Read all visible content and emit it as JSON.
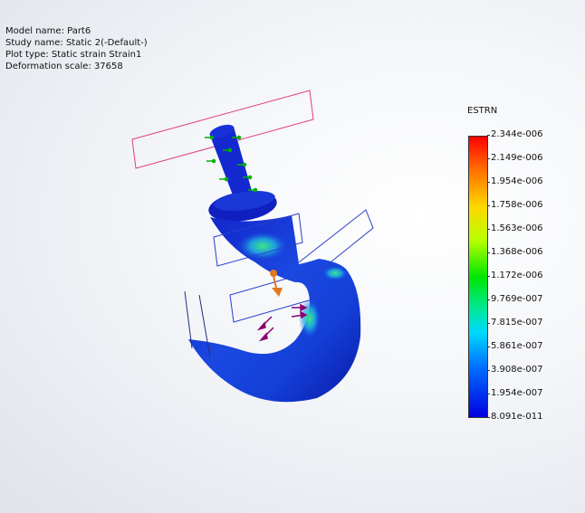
{
  "info": {
    "model_name": "Model name: Part6",
    "study_name": "Study name: Static 2(-Default-)",
    "plot_type": "Plot type: Static strain Strain1",
    "deformation_scale": "Deformation scale: 37658"
  },
  "legend": {
    "title": "ESTRN",
    "ticks": [
      "2.344e-006",
      "2.149e-006",
      "1.954e-006",
      "1.758e-006",
      "1.563e-006",
      "1.368e-006",
      "1.172e-006",
      "9.769e-007",
      "7.815e-007",
      "5.861e-007",
      "3.908e-007",
      "1.954e-007",
      "8.091e-011"
    ]
  },
  "colors": {
    "max": "#ff0000",
    "min": "#0000e0",
    "fixture": "#00b000",
    "load": "#8b0070",
    "plane_red": "#e0407a",
    "plane_blue": "#2840c8"
  }
}
